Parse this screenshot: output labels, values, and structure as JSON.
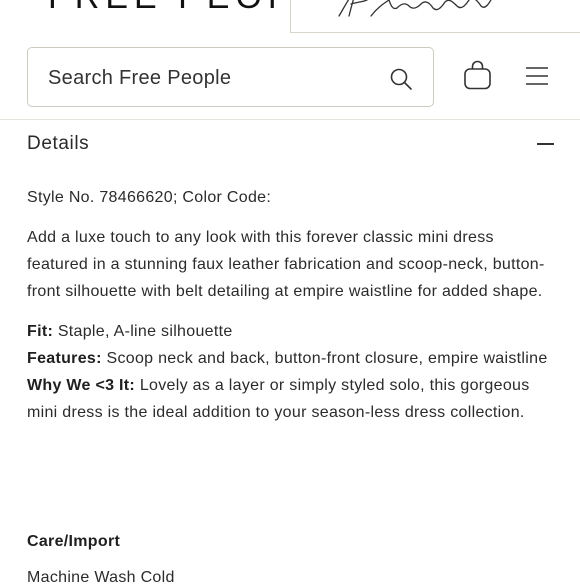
{
  "brand": {
    "logo_text": "FREE PEOPLE",
    "secondary_logo_text": "fpmovement"
  },
  "search": {
    "placeholder": "Search Free People"
  },
  "icons": {
    "search": "search-icon",
    "bag": "shopping-bag-icon",
    "menu": "hamburger-menu-icon",
    "collapse": "minus-icon"
  },
  "details": {
    "title": "Details",
    "style_line": "Style No. 78466620; Color Code:",
    "description": "Add a luxe touch to any look with this forever classic mini dress featured in a stunning faux leather fabrication and scoop-neck, button-front silhouette with belt detailing at empire waistline for added shape.",
    "fit_label": "Fit:",
    "fit_value": " Staple, A-line silhouette",
    "features_label": "Features:",
    "features_value": " Scoop neck and back, button-front closure, empire waistline",
    "why_label": "Why We <3 It:",
    "why_value": " Lovely as a layer or simply styled solo, this gorgeous mini dress is the ideal addition to your season-less dress collection."
  },
  "care": {
    "heading": "Care/Import",
    "line": "Machine Wash Cold"
  },
  "colors": {
    "text": "#222222",
    "border": "#cfcac1",
    "divider": "#e6e3dd"
  }
}
